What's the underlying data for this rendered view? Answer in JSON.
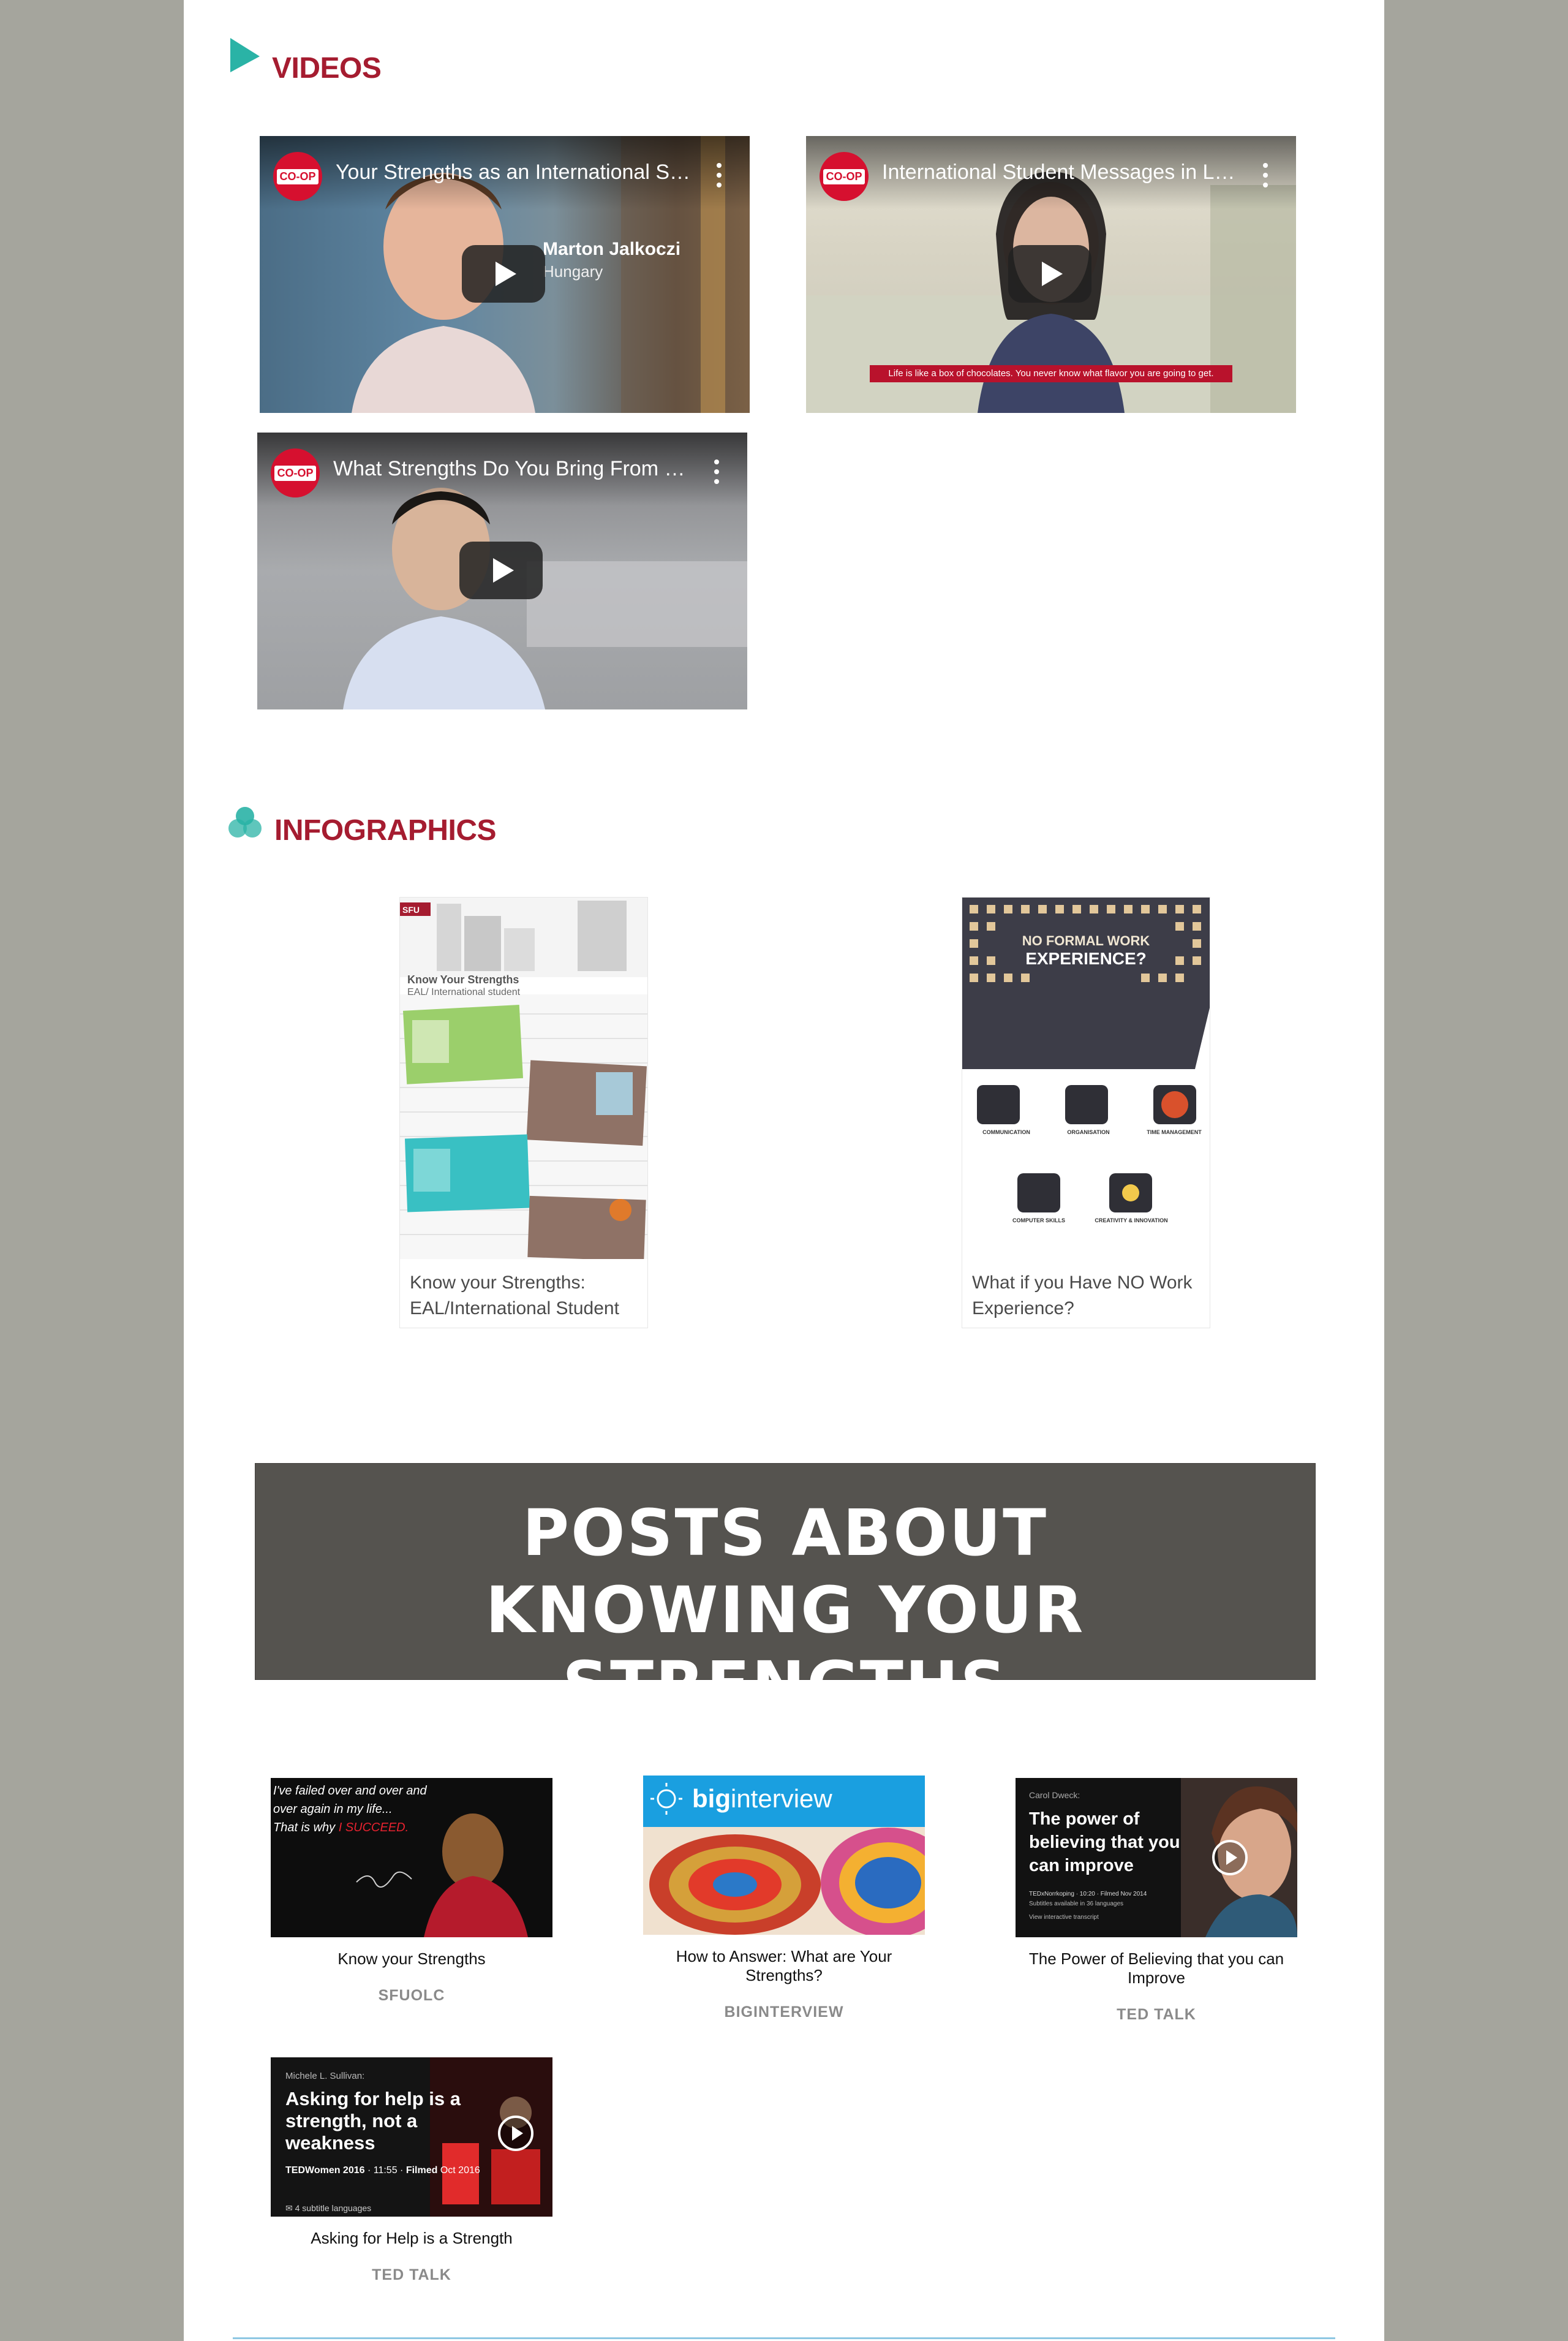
{
  "videos_section": {
    "heading": "VIDEOS",
    "items": [
      {
        "title": "Your Strengths as an International Student",
        "channel_badge": "CO-OP",
        "lower_third_name": "Marton Jalkoczi",
        "lower_third_sub": "Hungary"
      },
      {
        "title": "International Student Messages in Lockdown",
        "channel_badge": "CO-OP",
        "subtitle": "Life is like a box of chocolates. You never know what flavor you are going to get."
      },
      {
        "title": "What Strengths Do You Bring From Home",
        "channel_badge": "CO-OP"
      }
    ]
  },
  "infographics_section": {
    "heading": "INFOGRAPHICS",
    "items": [
      {
        "caption": "Know your Strengths: EAL/International Student",
        "inner_title": "Know Your Strengths",
        "inner_sub": "EAL/ International student",
        "logo": "SFU"
      },
      {
        "caption": "What if you Have NO Work Experience?",
        "inner_title_1": "NO FORMAL WORK",
        "inner_title_2": "EXPERIENCE?",
        "skills": [
          "COMMUNICATION",
          "ORGANISATION",
          "TIME MANAGEMENT",
          "COMPUTER SKILLS",
          "CREATIVITY & INNOVATION"
        ]
      }
    ]
  },
  "posts_banner": {
    "line1": "POSTS ABOUT",
    "line2": "KNOWING YOUR STRENGTHS"
  },
  "posts": [
    {
      "title": "Know your Strengths",
      "source": "SFUOLC",
      "thumb_text_1": "I've failed over and over and",
      "thumb_text_2": "over again in my life...",
      "thumb_text_3": "That is why ",
      "thumb_text_highlight": "I SUCCEED."
    },
    {
      "title": "How to Answer: What are Your Strengths?",
      "source": "BIGINTERVIEW",
      "thumb_brand_bold": "big",
      "thumb_brand_rest": "interview"
    },
    {
      "title": "The Power of Believing that you can Improve",
      "source": "TED TALK",
      "thumb_speaker": "Carol Dweck:",
      "thumb_headline": "The power of believing that you can improve",
      "thumb_meta": "TEDxNorrkoping · 10:20 · Filmed Nov 2014",
      "thumb_meta2": "Subtitles available in 36 languages",
      "thumb_meta3": "View interactive transcript"
    },
    {
      "title": "Asking for Help is a Strength",
      "source": "TED TALK",
      "thumb_speaker": "Michele L. Sullivan:",
      "thumb_headline": "Asking for help is a strength, not a weakness",
      "thumb_meta_event": "TEDWomen 2016",
      "thumb_meta_rest": " · 11:55 · ",
      "thumb_meta_filmed": "Filmed",
      "thumb_meta_date": " Oct 2016",
      "thumb_meta2": "4 subtitle languages"
    }
  ],
  "colors": {
    "heading": "#a51c30",
    "accent_teal": "#2ab3a6",
    "banner_bg": "#55534f",
    "side_bg": "#a5a59d"
  }
}
